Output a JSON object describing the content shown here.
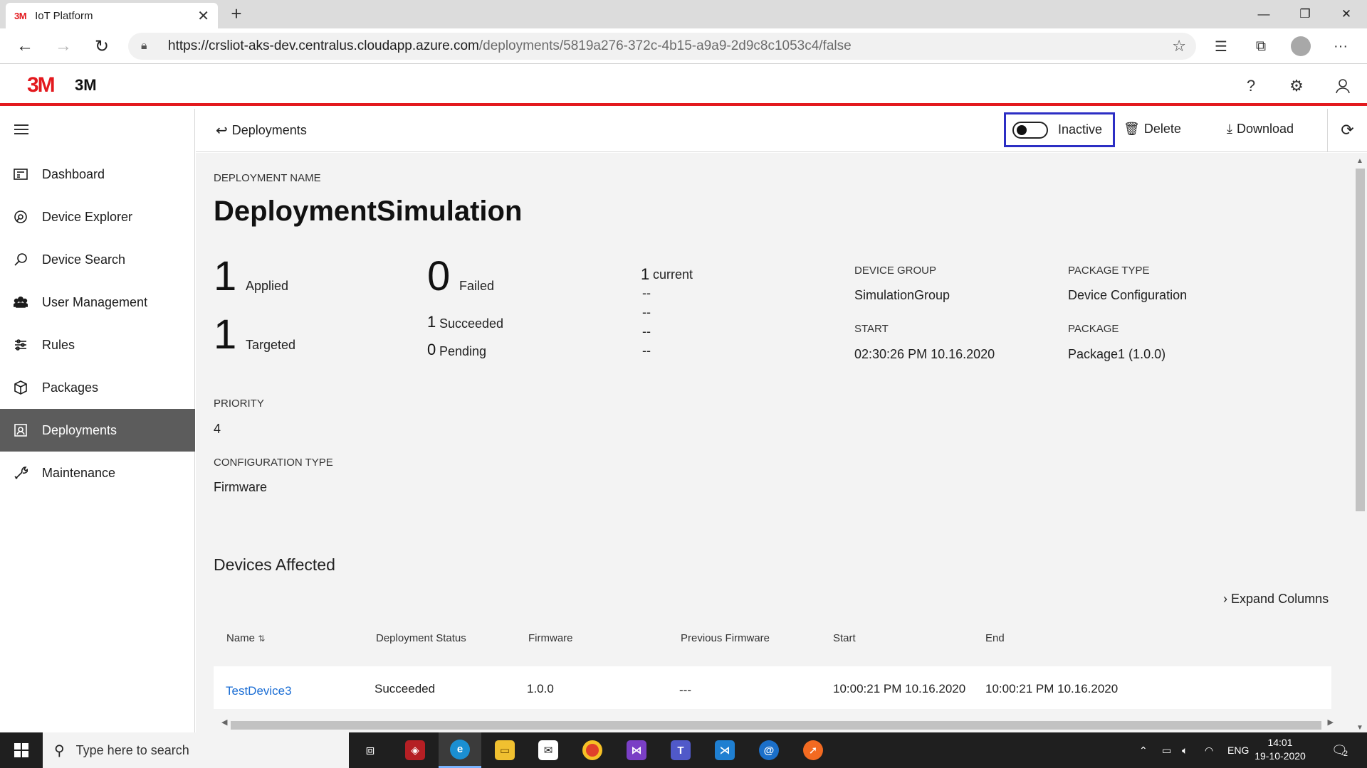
{
  "browser": {
    "tab_title": "IoT Platform",
    "tab_favicon": "3M",
    "url_host": "https://crsliot-aks-dev.centralus.cloudapp.azure.com",
    "url_path": "/deployments/5819a276-372c-4b15-a9a9-2d9c8c1053c4/false"
  },
  "header": {
    "logo": "3M",
    "brand": "3M"
  },
  "sidebar": {
    "items": [
      {
        "label": "Dashboard",
        "icon": "dashboard-icon"
      },
      {
        "label": "Device Explorer",
        "icon": "device-explorer-icon"
      },
      {
        "label": "Device Search",
        "icon": "search-icon"
      },
      {
        "label": "User Management",
        "icon": "users-icon"
      },
      {
        "label": "Rules",
        "icon": "rules-icon"
      },
      {
        "label": "Packages",
        "icon": "package-icon"
      },
      {
        "label": "Deployments",
        "icon": "deployments-icon",
        "active": true
      },
      {
        "label": "Maintenance",
        "icon": "maintenance-icon"
      }
    ]
  },
  "context": {
    "back_label": "Deployments",
    "toggle_label": "Inactive",
    "toggle_on": false,
    "delete_label": "Delete",
    "download_label": "Download"
  },
  "deployment": {
    "name_label": "DEPLOYMENT NAME",
    "name": "DeploymentSimulation",
    "applied_count": "1",
    "applied_label": "Applied",
    "targeted_count": "1",
    "targeted_label": "Targeted",
    "failed_count": "0",
    "failed_label": "Failed",
    "succeeded_count": "1",
    "succeeded_label": "Succeeded",
    "pending_count": "0",
    "pending_label": "Pending",
    "current_count": "1",
    "current_label": "current",
    "dash_values": [
      "--",
      "--",
      "--",
      "--"
    ],
    "device_group_label": "DEVICE GROUP",
    "device_group": "SimulationGroup",
    "start_label": "START",
    "start": "02:30:26 PM 10.16.2020",
    "package_type_label": "PACKAGE TYPE",
    "package_type": "Device Configuration",
    "package_label": "PACKAGE",
    "package": "Package1 (1.0.0)",
    "priority_label": "PRIORITY",
    "priority": "4",
    "config_type_label": "CONFIGURATION TYPE",
    "config_type": "Firmware"
  },
  "devices": {
    "title": "Devices Affected",
    "expand_label": "Expand Columns",
    "columns": [
      "Name",
      "Deployment Status",
      "Firmware",
      "Previous Firmware",
      "Start",
      "End"
    ],
    "rows": [
      [
        "TestDevice3",
        "Succeeded",
        "1.0.0",
        "---",
        "10:00:21 PM 10.16.2020",
        "10:00:21 PM 10.16.2020"
      ]
    ]
  },
  "taskbar": {
    "search_placeholder": "Type here to search",
    "language": "ENG",
    "time": "14:01",
    "date": "19-10-2020",
    "notifications": "2"
  },
  "colors": {
    "brand_red": "#e3191e",
    "focus_outline": "#2c2ec4",
    "link": "#1a6dd4",
    "active_nav": "#5c5c5c"
  }
}
